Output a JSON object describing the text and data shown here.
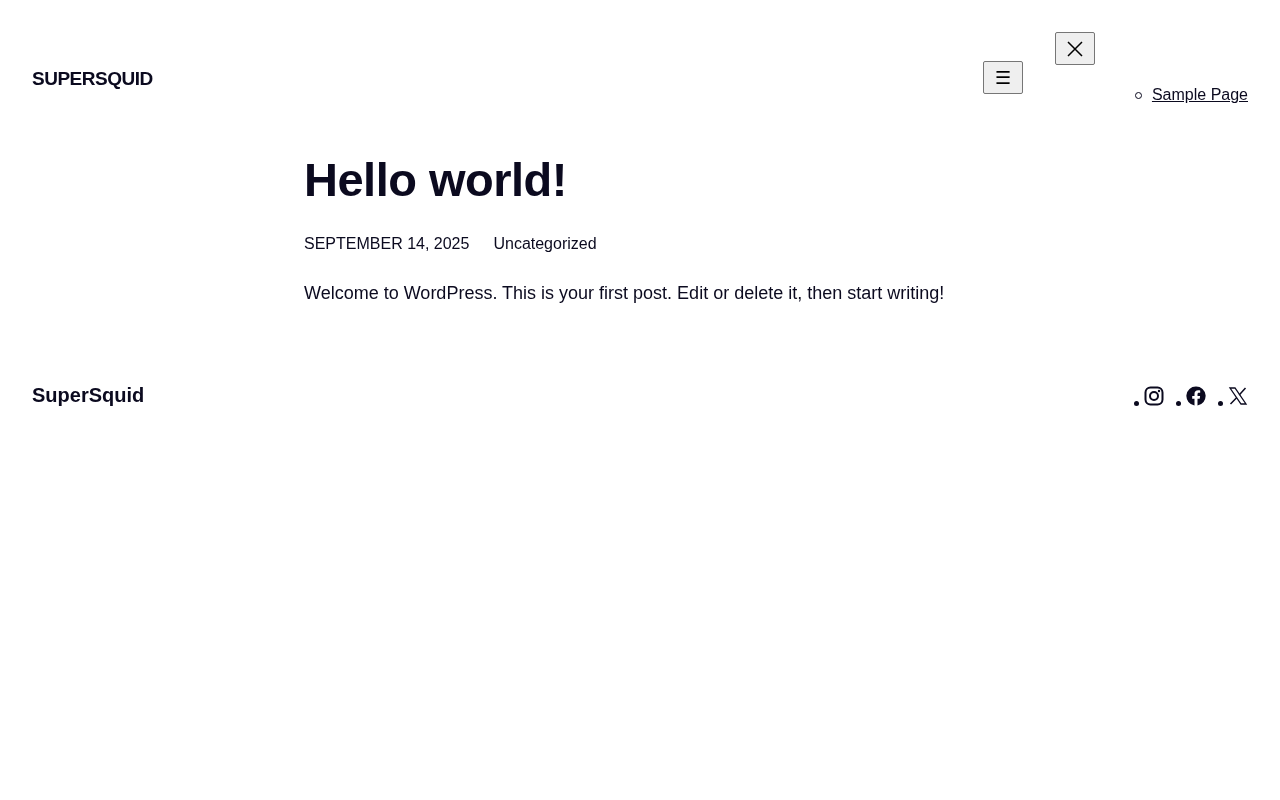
{
  "header": {
    "site_title": "SUPERSQUID",
    "menu_button": "☰",
    "nav": [
      {
        "label": "Sample Page"
      }
    ]
  },
  "post": {
    "title": "Hello world!",
    "date": "SEPTEMBER 14, 2025",
    "category": "Uncategorized",
    "body": "Welcome to WordPress. This is your first post. Edit or delete it, then start writing!"
  },
  "footer": {
    "site_title": "SuperSquid",
    "social": [
      {
        "kind": "instagram"
      },
      {
        "kind": "facebook"
      },
      {
        "kind": "x"
      }
    ]
  }
}
